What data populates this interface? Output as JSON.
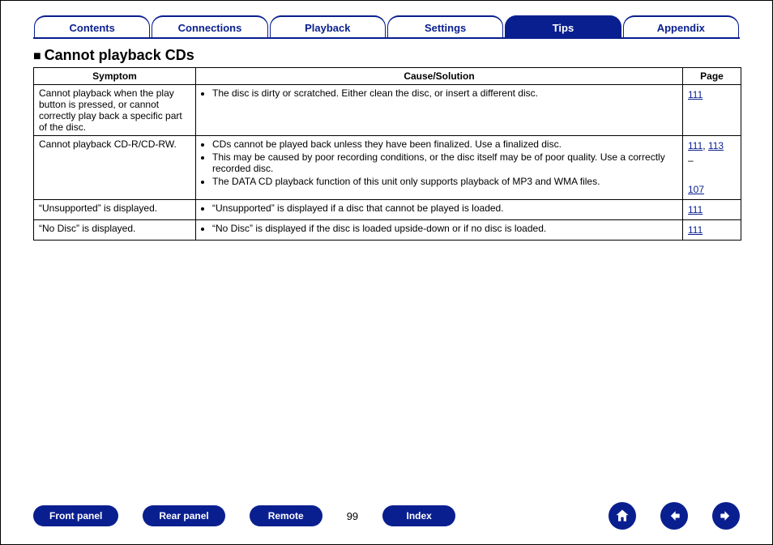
{
  "tabs": [
    "Contents",
    "Connections",
    "Playback",
    "Settings",
    "Tips",
    "Appendix"
  ],
  "active_tab": 4,
  "section_title": "Cannot playback CDs",
  "table": {
    "headers": {
      "symptom": "Symptom",
      "cause": "Cause/Solution",
      "page": "Page"
    },
    "rows": [
      {
        "symptom": "Cannot playback when the play button is pressed, or cannot correctly play back a specific part of the disc.",
        "causes": [
          "The disc is dirty or scratched. Either clean the disc, or insert a different disc."
        ],
        "pages_html": "<span class='plink'>111</span>"
      },
      {
        "symptom": "Cannot playback CD-R/CD-RW.",
        "causes": [
          "CDs cannot be played back unless they have been finalized. Use a finalized disc.",
          "This may be caused by poor recording conditions, or the disc itself may be of poor quality. Use a correctly recorded disc.",
          "The DATA CD playback function of this unit only supports playback of MP3 and WMA files."
        ],
        "pages_html": "<span class='plink'>111</span>, <span class='plink'>113</span><br>–<br><br><span class='plink'>107</span>"
      },
      {
        "symptom": "“Unsupported” is displayed.",
        "causes": [
          "“Unsupported” is displayed if a disc that cannot be played is loaded."
        ],
        "pages_html": "<span class='plink'>111</span>"
      },
      {
        "symptom": "“No Disc” is displayed.",
        "causes": [
          "“No Disc” is displayed if the disc is loaded upside-down or if no disc is loaded."
        ],
        "pages_html": "<span class='plink'>111</span>"
      }
    ]
  },
  "footer": {
    "buttons": [
      "Front panel",
      "Rear panel",
      "Remote"
    ],
    "page_number": "99",
    "index": "Index"
  }
}
